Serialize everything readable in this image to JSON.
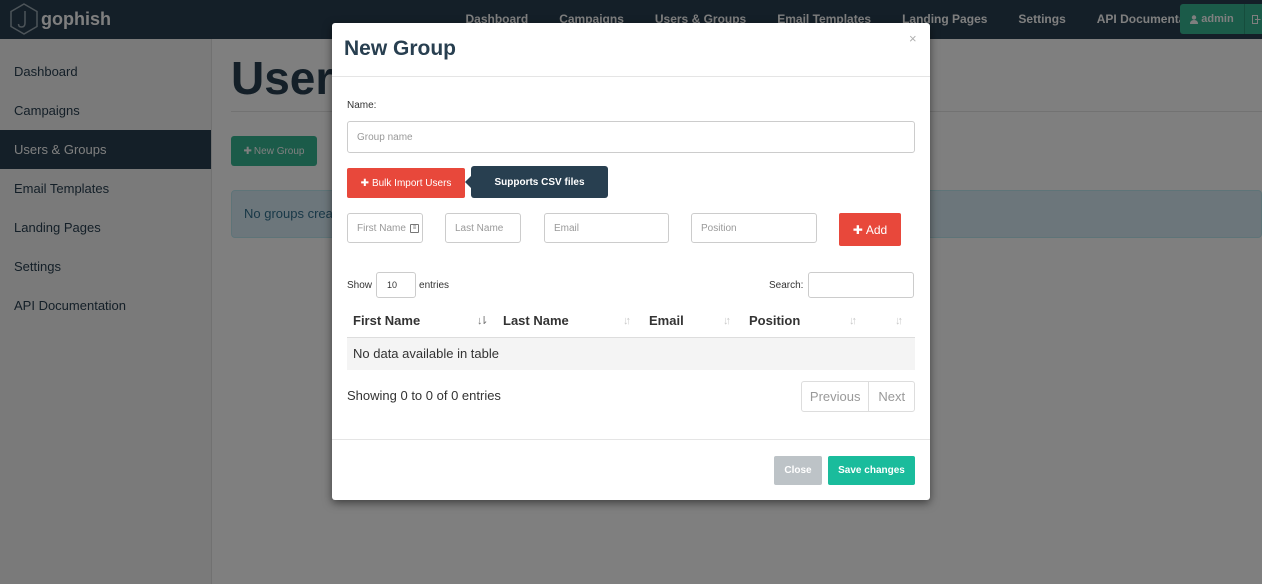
{
  "navbar": {
    "brand": "gophish",
    "brand_icon": "gophish-hook-logo",
    "links": [
      "Dashboard",
      "Campaigns",
      "Users & Groups",
      "Email Templates",
      "Landing Pages",
      "Settings",
      "API Documentation"
    ],
    "user_label": "admin",
    "user_icon": "user-icon",
    "logout_icon": "sign-out-icon"
  },
  "sidebar": {
    "items": [
      {
        "label": "Dashboard",
        "active": false
      },
      {
        "label": "Campaigns",
        "active": false
      },
      {
        "label": "Users & Groups",
        "active": true
      },
      {
        "label": "Email Templates",
        "active": false
      },
      {
        "label": "Landing Pages",
        "active": false
      },
      {
        "label": "Settings",
        "active": false
      },
      {
        "label": "API Documentation",
        "active": false
      }
    ]
  },
  "main": {
    "title": "Users & Groups",
    "new_group_label": "New Group",
    "new_group_icon": "plus-icon",
    "empty_alert": "No groups created yet. Let's create one!"
  },
  "modal": {
    "title": "New Group",
    "close_symbol": "×",
    "name_label": "Name:",
    "group_name_placeholder": "Group name",
    "bulk_import_label": "Bulk Import Users",
    "bulk_import_icon": "plus-icon",
    "tooltip": "Supports CSV files",
    "fields": {
      "first_name_placeholder": "First Name",
      "last_name_placeholder": "Last Name",
      "email_placeholder": "Email",
      "position_placeholder": "Position"
    },
    "add_label": "Add",
    "add_icon": "plus-icon",
    "table": {
      "show_label": "Show",
      "length_value": "10",
      "entries_label": "entries",
      "search_label": "Search:",
      "columns": [
        "First Name",
        "Last Name",
        "Email",
        "Position"
      ],
      "empty_text": "No data available in table",
      "info": "Showing 0 to 0 of 0 entries",
      "prev_label": "Previous",
      "next_label": "Next"
    },
    "footer": {
      "close_label": "Close",
      "save_label": "Save changes"
    }
  },
  "colors": {
    "navbar": "#283f50",
    "primary_green": "#37b693",
    "danger_red": "#e8483b",
    "save_teal": "#1abc9c",
    "close_grey": "#bdc3c7"
  }
}
